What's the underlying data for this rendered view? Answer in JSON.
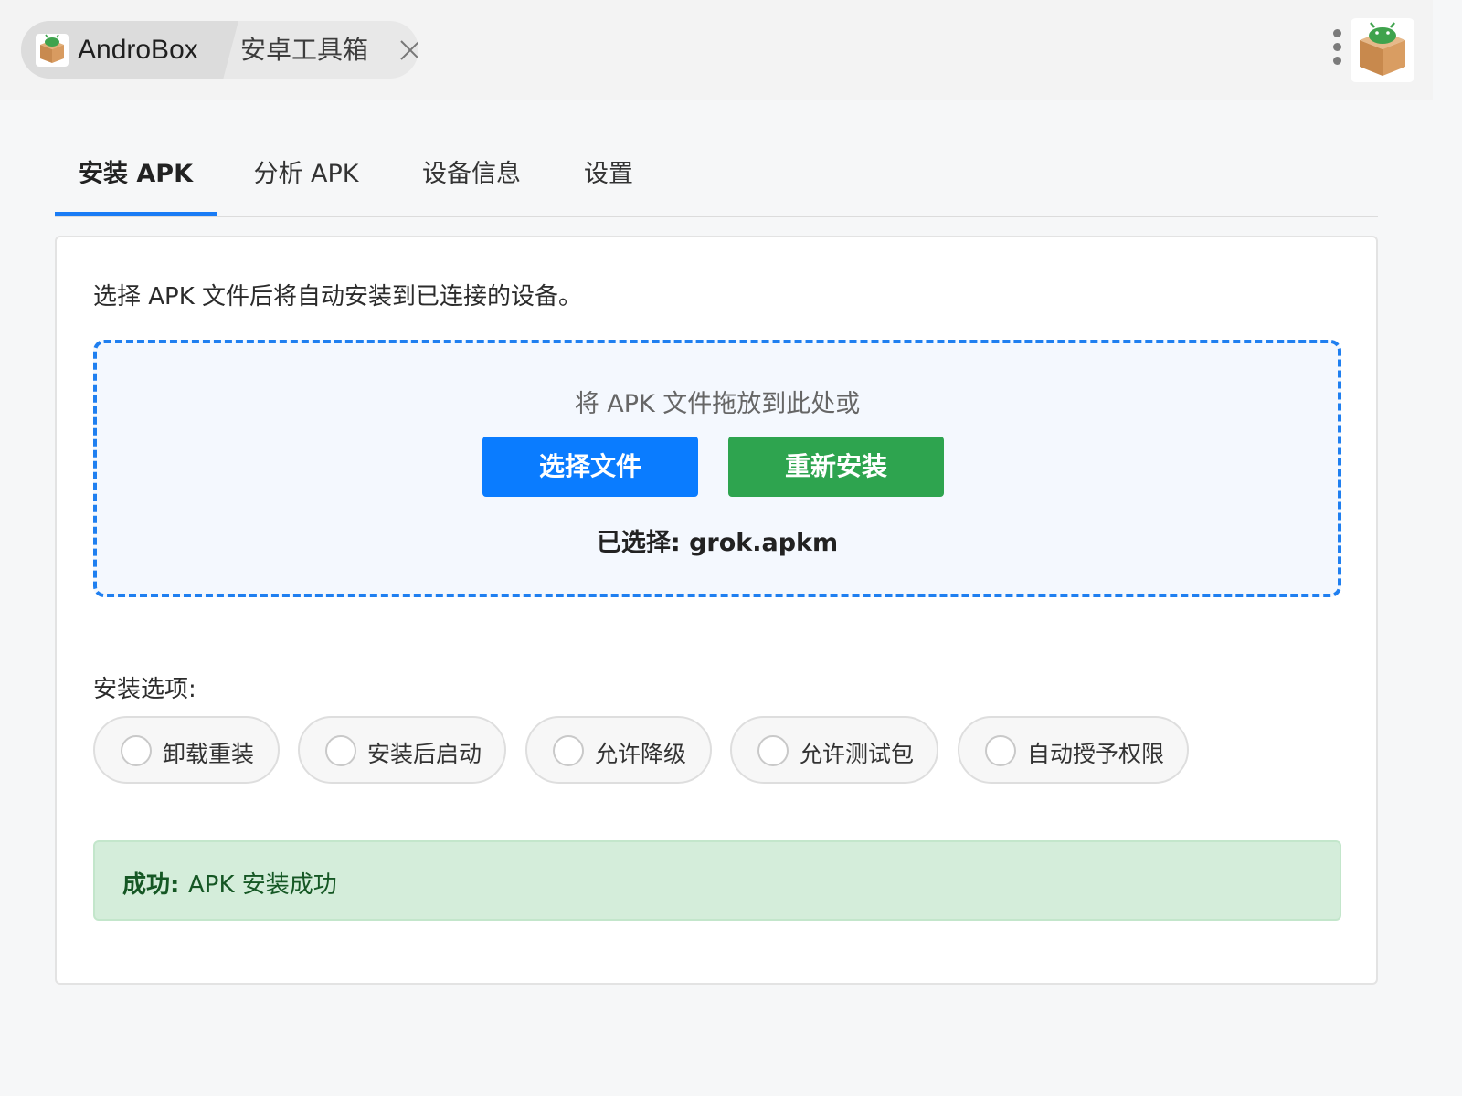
{
  "titlebar": {
    "app_name": "AndroBox",
    "subtitle": "安卓工具箱",
    "icons": [
      "package-icon",
      "close-icon",
      "kebab-menu-icon"
    ]
  },
  "tabs": [
    {
      "label": "安装 APK",
      "active": true
    },
    {
      "label": "分析 APK",
      "active": false
    },
    {
      "label": "设备信息",
      "active": false
    },
    {
      "label": "设置",
      "active": false
    }
  ],
  "install": {
    "intro": "选择 APK 文件后将自动安装到已连接的设备。",
    "drop_hint": "将 APK 文件拖放到此处或",
    "choose_button": "选择文件",
    "reinstall_button": "重新安装",
    "selected_file": "已选择: grok.apkm"
  },
  "options": {
    "label": "安装选项:",
    "items": [
      {
        "label": "卸载重装",
        "checked": false
      },
      {
        "label": "安装后启动",
        "checked": false
      },
      {
        "label": "允许降级",
        "checked": false
      },
      {
        "label": "允许测试包",
        "checked": false
      },
      {
        "label": "自动授予权限",
        "checked": false
      }
    ]
  },
  "alert": {
    "status": "成功:",
    "message": "APK 安装成功"
  },
  "colors": {
    "accent": "#1a7cf5",
    "primary_button": "#0a7cff",
    "success_button": "#2ea44f",
    "success_bg": "#d4edda",
    "success_text": "#155724"
  }
}
